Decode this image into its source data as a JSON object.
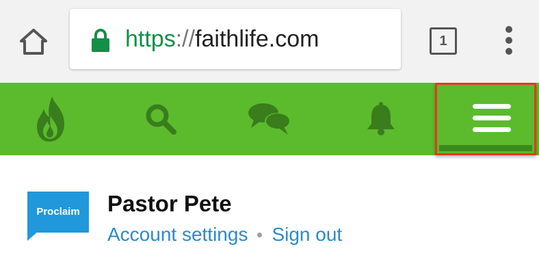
{
  "browser": {
    "url_scheme": "https",
    "url_separator": "://",
    "url_host": "faithlife.com",
    "tab_count": "1",
    "icons": {
      "home": "home-icon",
      "lock": "lock-icon",
      "tabs": "tabs-icon",
      "menu": "overflow-menu-icon"
    },
    "colors": {
      "secure": "#148f47",
      "chrome_bg": "#f2f2f2"
    }
  },
  "site_nav": {
    "bg_color": "#5bbb2d",
    "icon_color": "#3a7d1c",
    "items": [
      {
        "name": "faithlife-logo-icon"
      },
      {
        "name": "search-icon"
      },
      {
        "name": "messages-icon"
      },
      {
        "name": "notifications-bell-icon"
      },
      {
        "name": "hamburger-menu-icon",
        "highlighted": true
      }
    ],
    "highlight_color": "#e8381a"
  },
  "profile": {
    "logo_text": "Proclaim",
    "name": "Pastor Pete",
    "account_settings": "Account settings",
    "sign_out": "Sign out",
    "link_color": "#2b8ac9"
  }
}
